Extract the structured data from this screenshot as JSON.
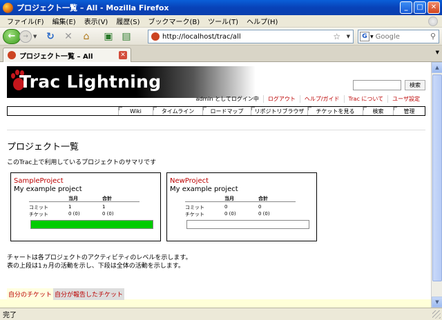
{
  "window": {
    "title": "プロジェクト一覧 – All - Mozilla Firefox"
  },
  "menu": [
    "ファイル(F)",
    "編集(E)",
    "表示(V)",
    "履歴(S)",
    "ブックマーク(B)",
    "ツール(T)",
    "ヘルプ(H)"
  ],
  "navbar": {
    "url": "http://localhost/trac/all",
    "search_placeholder": "Google",
    "engine_letter": "G"
  },
  "tab": {
    "label": "プロジェクト一覧 – All"
  },
  "trac": {
    "logo_text": "Trac Lightning",
    "search_button": "検索",
    "metanav": {
      "user": "admin としてログイン中",
      "links": [
        "ログアウト",
        "ヘルプ/ガイド",
        "Trac について",
        "ユーザ設定"
      ]
    },
    "mainnav": [
      "Wiki",
      "タイムライン",
      "ロードマップ",
      "リポジトリブラウザ",
      "チケットを見る",
      "検索",
      "管理"
    ],
    "page_title": "プロジェクト一覧",
    "page_desc": "このTrac上で利用しているプロジェクトのサマリです",
    "stat_headers": {
      "month": "当月",
      "total": "合計"
    },
    "row_labels": {
      "commits": "コミット",
      "tickets": "チケット"
    },
    "projects": [
      {
        "name": "SampleProject",
        "desc": "My example project",
        "commits_month": "1",
        "commits_total": "1",
        "tickets_month": "0 (0)",
        "tickets_total": "0 (0)",
        "activity": 1.0
      },
      {
        "name": "NewProject",
        "desc": "My example project",
        "commits_month": "0",
        "commits_total": "0",
        "tickets_month": "0 (0)",
        "tickets_total": "0 (0)",
        "activity": 0.0
      }
    ],
    "chart_note": [
      "チャートは各プロジェクトのアクティビティのレベルを示します。",
      "表の上段は1ヵ月の活動を示し、下段は全体の活動を示します。"
    ],
    "ticket_links": [
      "自分のチケット",
      "自分が報告したチケット"
    ]
  },
  "status": {
    "text": "完了"
  },
  "colors": {
    "link": "#bb0000",
    "activity_bar": "#00cc00"
  }
}
